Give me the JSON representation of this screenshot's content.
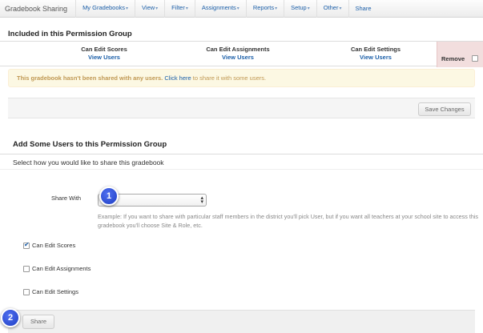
{
  "navbar": {
    "brand": "Gradebook Sharing",
    "items": [
      {
        "label": "My Gradebooks",
        "dropdown": true
      },
      {
        "label": "View",
        "dropdown": true
      },
      {
        "label": "Filter",
        "dropdown": true
      },
      {
        "label": "Assignments",
        "dropdown": true
      },
      {
        "label": "Reports",
        "dropdown": true
      },
      {
        "label": "Setup",
        "dropdown": true
      },
      {
        "label": "Other",
        "dropdown": true
      },
      {
        "label": "Share",
        "dropdown": false
      }
    ]
  },
  "permission_group": {
    "title": "Included in this Permission Group",
    "columns": [
      {
        "title": "Can Edit Scores",
        "link": "View Users"
      },
      {
        "title": "Can Edit Assignments",
        "link": "View Users"
      },
      {
        "title": "Can Edit Settings",
        "link": "View Users"
      }
    ],
    "remove_label": "Remove",
    "alert": {
      "text": "This gradebook hasn't been shared with any users.",
      "link": "Click here",
      "rest": "to share it with some users."
    },
    "save_button": "Save Changes"
  },
  "add_users": {
    "title": "Add Some Users to this Permission Group",
    "subtitle": "Select how you would like to share this gradebook",
    "share_with_label": "Share With",
    "share_with_value": "",
    "example": "Example: If you want to share with particular staff members in the district you'll pick User, but if you want all teachers at your school site to access this gradebook you'll choose Site & Role, etc.",
    "checkboxes": [
      {
        "label": "Can Edit Scores",
        "checked": true
      },
      {
        "label": "Can Edit Assignments",
        "checked": false
      },
      {
        "label": "Can Edit Settings",
        "checked": false
      }
    ],
    "share_button": "Share"
  },
  "callouts": [
    "1",
    "2"
  ],
  "colors": {
    "link": "#1a5ea8",
    "alert_text": "#c09853",
    "alert_bg": "#fcf8e3",
    "remove_bg": "#f2dede",
    "callout": "#2f52d8"
  }
}
